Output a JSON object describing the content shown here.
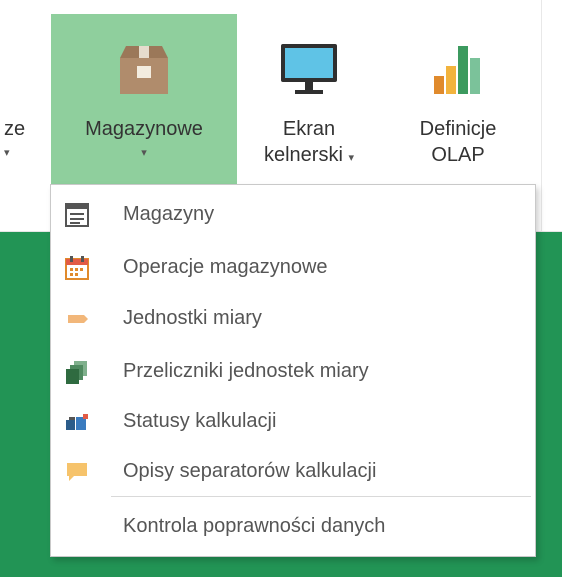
{
  "ribbon": {
    "partial_button": {
      "label": "ze"
    },
    "buttons": [
      {
        "label": "Magazynowe"
      },
      {
        "label_line1": "Ekran",
        "label_line2": "kelnerski"
      },
      {
        "label_line1": "Definicje",
        "label_line2": "OLAP"
      }
    ],
    "caret": "▾"
  },
  "menu": {
    "items": [
      {
        "label": "Magazyny",
        "icon": "warehouse-list-icon"
      },
      {
        "label": "Operacje magazynowe",
        "icon": "calendar-icon"
      },
      {
        "label": "Jednostki miary",
        "icon": "tag-icon"
      },
      {
        "label": "Przeliczniki jednostek miary",
        "icon": "copy-stack-icon"
      },
      {
        "label": "Statusy kalkulacji",
        "icon": "status-blocks-icon"
      },
      {
        "label": "Opisy separatorów kalkulacji",
        "icon": "speech-bubble-icon"
      },
      {
        "label": "Kontrola poprawności danych",
        "icon": ""
      }
    ]
  },
  "colors": {
    "accent_green": "#229455",
    "active_button": "#8fcf9d",
    "text": "#555555"
  }
}
